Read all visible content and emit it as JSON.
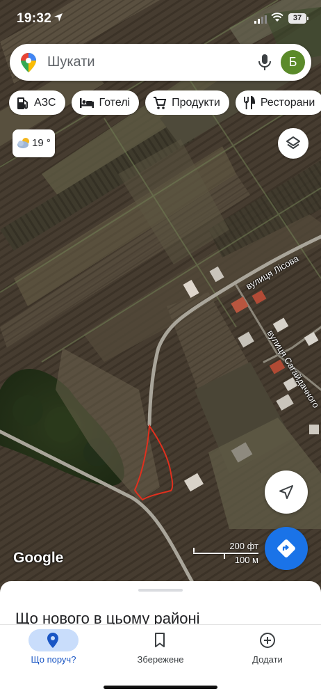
{
  "status_bar": {
    "time": "19:32",
    "battery": "37"
  },
  "search": {
    "placeholder": "Шукати",
    "avatar_letter": "Б"
  },
  "chips": [
    {
      "label": "АЗС",
      "icon": "gas-station-icon"
    },
    {
      "label": "Готелі",
      "icon": "bed-icon"
    },
    {
      "label": "Продукти",
      "icon": "cart-icon"
    },
    {
      "label": "Ресторани",
      "icon": "fork-knife-icon"
    }
  ],
  "weather": {
    "temp": "19 °",
    "icon": "partly-cloudy-icon"
  },
  "map": {
    "streets": [
      "вулиця Лісова",
      "вулиця Сагайдачного"
    ],
    "attribution": "Google",
    "scale": {
      "imperial": "200 фт",
      "metric": "100 м"
    },
    "colors": {
      "parcel_outline": "#e0301e",
      "road": "#a9a59a"
    }
  },
  "sheet": {
    "title": "Що нового в цьому районі"
  },
  "nav": {
    "items": [
      {
        "label": "Що поруч?",
        "icon": "place-pin-icon",
        "active": true
      },
      {
        "label": "Збережене",
        "icon": "bookmark-icon",
        "active": false
      },
      {
        "label": "Додати",
        "icon": "add-circle-icon",
        "active": false
      }
    ]
  },
  "colors": {
    "accent": "#1a73e8",
    "active_pill": "#c9ddfb",
    "avatar_bg": "#5b8a2a"
  }
}
